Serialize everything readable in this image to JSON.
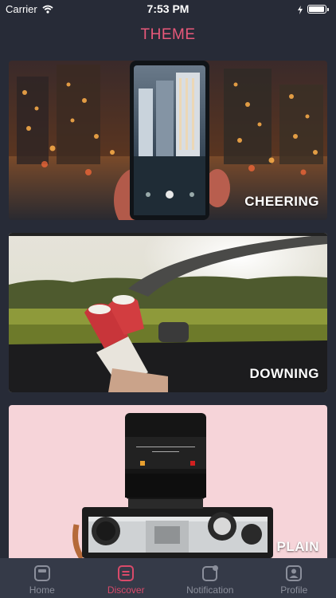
{
  "status_bar": {
    "carrier": "Carrier",
    "time": "7:53 PM"
  },
  "header": {
    "title": "THEME",
    "accent_color": "#e8587a"
  },
  "themes": [
    {
      "label": "CHEERING"
    },
    {
      "label": "DOWNING"
    },
    {
      "label": "PLAIN"
    }
  ],
  "tab_bar": {
    "active_color": "#d94a6a",
    "inactive_color": "#8b8f9b",
    "items": [
      {
        "label": "Home",
        "icon": "home-icon"
      },
      {
        "label": "Discover",
        "icon": "discover-icon",
        "active": true
      },
      {
        "label": "Notification",
        "icon": "notification-icon"
      },
      {
        "label": "Profile",
        "icon": "profile-icon"
      }
    ]
  }
}
